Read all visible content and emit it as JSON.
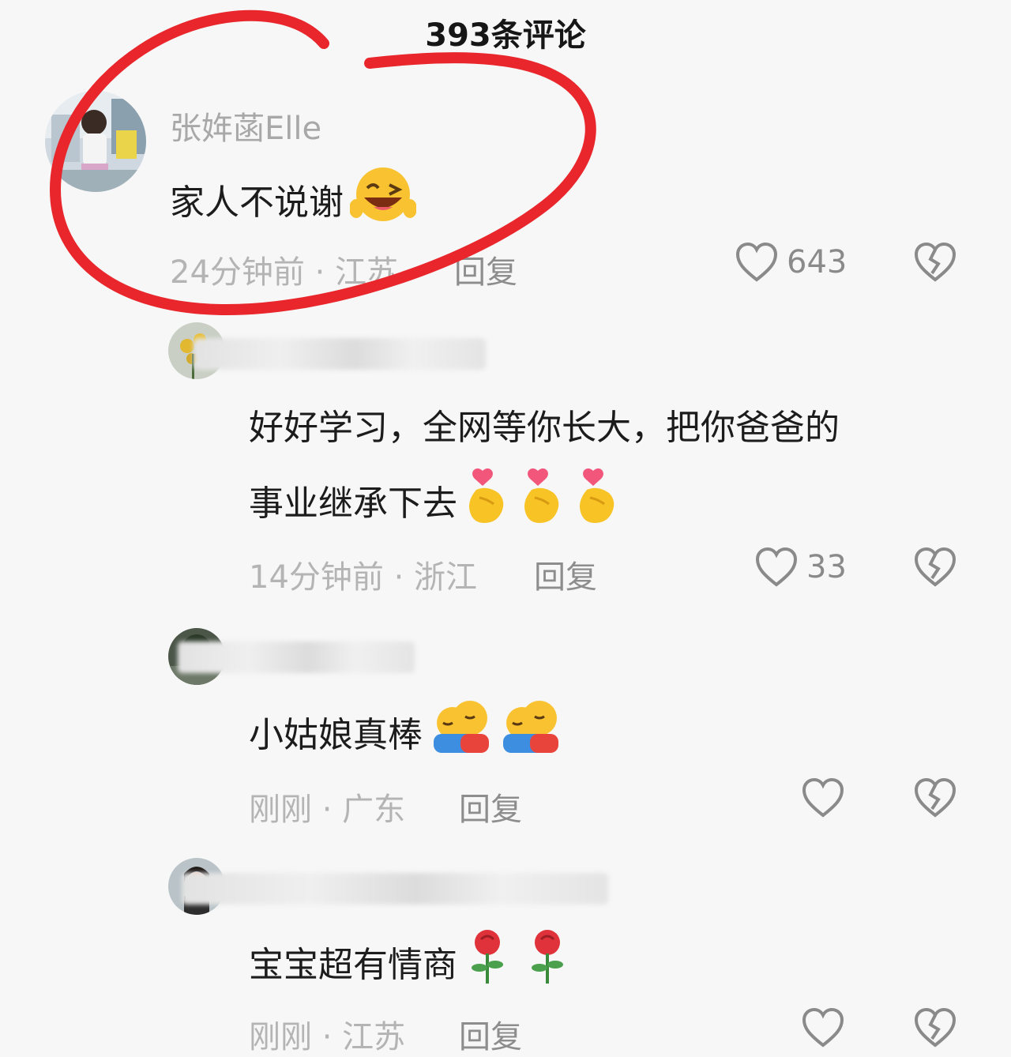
{
  "header": {
    "title": "393条评论"
  },
  "comments": [
    {
      "username": "张姩菡Elle",
      "text": "家人不说谢",
      "emoji": "grinning-squint-icon",
      "time_location": "24分钟前 · 江苏",
      "reply_label": "回复",
      "likes": "643"
    },
    {
      "username": "",
      "text_line1": "好好学习，全网等你长大，把你爸爸的",
      "text_line2": "事业继承下去",
      "emoji": "finger-heart-icon",
      "time_location": "14分钟前 · 浙江",
      "reply_label": "回复",
      "likes": "33"
    },
    {
      "username": "",
      "text": "小姑娘真棒",
      "emoji": "hugging-face-icon",
      "time_location": "刚刚 · 广东",
      "reply_label": "回复",
      "likes": ""
    },
    {
      "username": "",
      "text": "宝宝超有情商",
      "emoji": "rose-icon",
      "time_location": "刚刚 · 江苏",
      "reply_label": "回复",
      "likes": ""
    }
  ],
  "colors": {
    "annotation": "#e8262b",
    "background": "#f7f7f7"
  }
}
